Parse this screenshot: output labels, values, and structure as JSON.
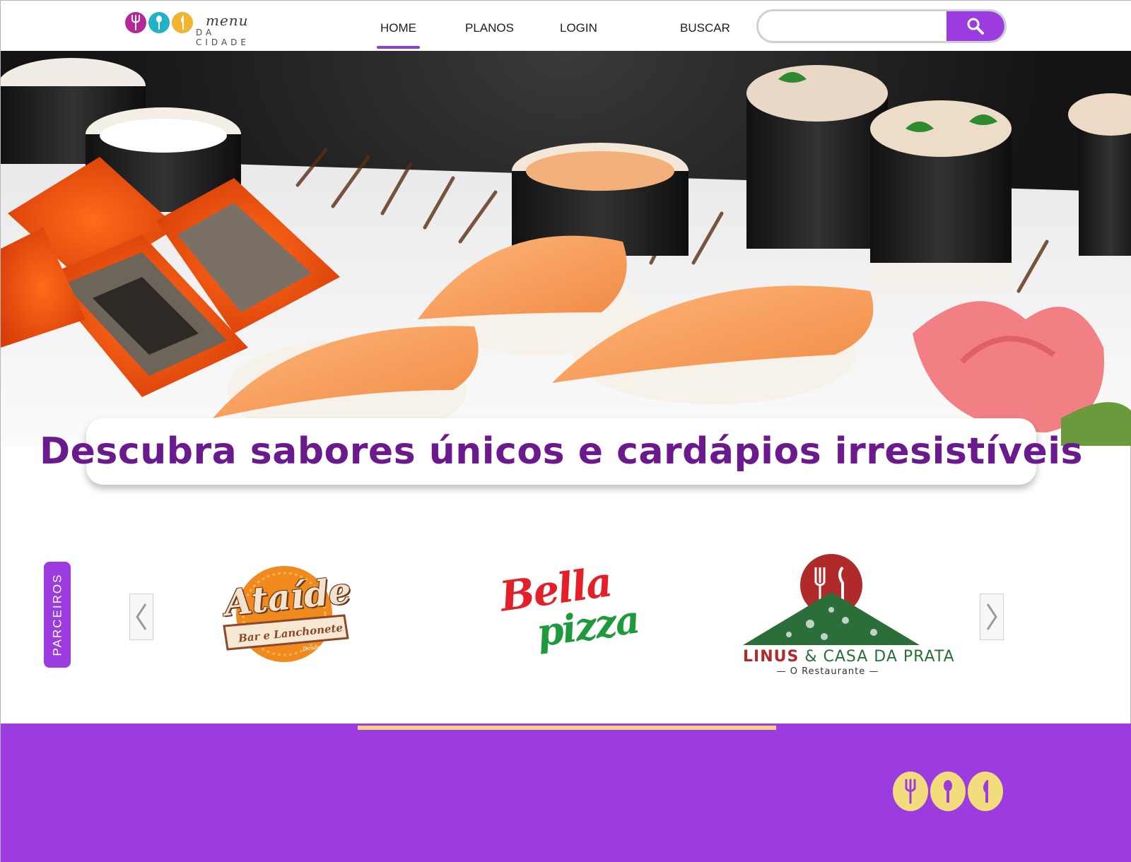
{
  "brand": {
    "name_top": "menu",
    "name_bottom": "DA CIDADE",
    "dot_colors": [
      "#b5279b",
      "#1fb3c5",
      "#f2b531"
    ],
    "accent": "#9b3be0",
    "footer_logo_color": "#f2dc7c"
  },
  "nav": {
    "items": [
      {
        "label": "HOME",
        "active": true
      },
      {
        "label": "PLANOS",
        "active": false
      },
      {
        "label": "LOGIN",
        "active": false
      },
      {
        "label": "BUSCAR",
        "active": false
      }
    ]
  },
  "search": {
    "value": "",
    "placeholder": "",
    "icon": "search-icon"
  },
  "hero": {
    "tagline": "Descubra sabores únicos e cardápios irresistíveis"
  },
  "partners": {
    "tab_label": "PARCEIROS",
    "items": [
      {
        "name": "Ataíde",
        "line1": "Bar e Lanchonete",
        "line2": "Desde 1978"
      },
      {
        "name_a": "Bella",
        "name_b": "pizza"
      },
      {
        "name_a": "LINUS",
        "name_b": "& CASA DA PRATA",
        "tagline": "O Restaurante"
      }
    ],
    "prev_icon": "chevron-left-icon",
    "next_icon": "chevron-right-icon"
  }
}
